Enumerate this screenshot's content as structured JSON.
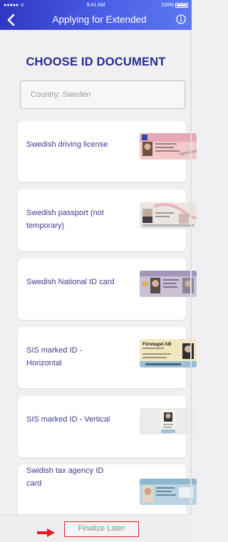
{
  "status_bar": {
    "signal": "●●●●● ᯤ",
    "time": "9:41 AM",
    "battery": "100%"
  },
  "header": {
    "title": "Applying for Extended"
  },
  "heading": "CHOOSE ID DOCUMENT",
  "country_field": {
    "value": "Country: Sweden"
  },
  "documents": [
    {
      "label": "Swedish driving license"
    },
    {
      "label": "Swedish passport (not temporary)"
    },
    {
      "label": "Swedish National ID card"
    },
    {
      "label": "SIS marked ID - Horizontal"
    },
    {
      "label": "SIS marked ID - Vertical"
    },
    {
      "label": "Swidish tax agency ID card"
    }
  ],
  "footer": {
    "finalize_label": "Finalize Later"
  },
  "colors": {
    "header_start": "#2f36c4",
    "header_end": "#5c78f0",
    "accent": "#252b8f",
    "highlight": "#e41e26"
  },
  "icons": {
    "back": "chevron-left-icon",
    "info": "info-icon",
    "arrow": "arrow-right-icon"
  }
}
